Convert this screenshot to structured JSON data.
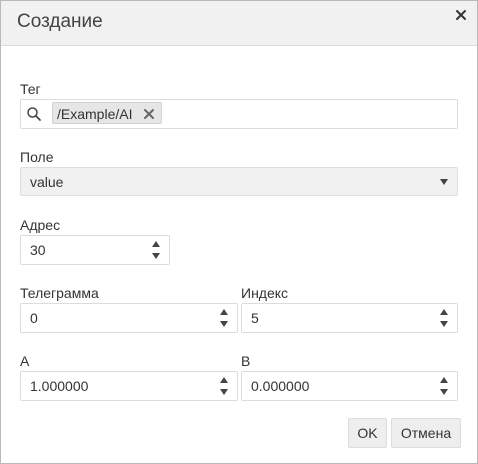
{
  "dialog": {
    "title": "Создание"
  },
  "tag": {
    "label": "Тег",
    "chip": "/Example/AI"
  },
  "field": {
    "label": "Поле",
    "value": "value"
  },
  "address": {
    "label": "Адрес",
    "value": "30"
  },
  "telegram": {
    "label": "Телеграмма",
    "value": "0"
  },
  "index": {
    "label": "Индекс",
    "value": "5"
  },
  "a": {
    "label": "A",
    "value": "1.000000"
  },
  "b": {
    "label": "B",
    "value": "0.000000"
  },
  "buttons": {
    "ok": "OK",
    "cancel": "Отмена"
  },
  "icons": {
    "close": "close-icon",
    "search": "search-icon",
    "remove_tag": "close-icon",
    "dropdown": "chevron-down-icon",
    "spinner": "spinner-arrows-icon"
  }
}
